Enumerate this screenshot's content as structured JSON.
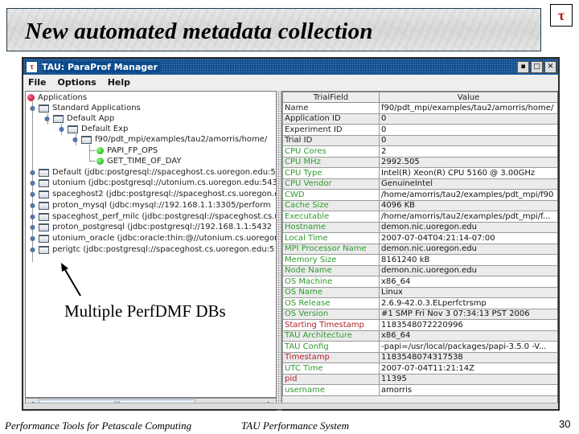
{
  "slide": {
    "title": "New automated metadata collection",
    "logo_glyph": "τ",
    "annotation": "Multiple PerfDMF DBs",
    "footer_left": "Performance Tools for Petascale Computing",
    "footer_center": "TAU Performance System",
    "page_number": "30"
  },
  "window": {
    "app_icon": "τ",
    "title": "TAU: ParaProf Manager",
    "controls": {
      "minimize": "▪",
      "maximize": "□",
      "close": "✕"
    },
    "menu": [
      "File",
      "Options",
      "Help"
    ]
  },
  "tree": {
    "root": "Applications",
    "nodes": [
      {
        "label": "Standard Applications"
      },
      {
        "label": "Default App"
      },
      {
        "label": "Default Exp"
      },
      {
        "label": "f90/pdt_mpi/examples/tau2/amorris/home/"
      },
      {
        "label": "PAPI_FP_OPS"
      },
      {
        "label": "GET_TIME_OF_DAY"
      },
      {
        "label": "Default (jdbc:postgresql://spaceghost.cs.uoregon.edu:5"
      },
      {
        "label": "utonium (jdbc:postgresql://utonium.cs.uoregon.edu:543"
      },
      {
        "label": "spaceghost2 (jdbc:postgresql://spaceghost.cs.uoregon.e"
      },
      {
        "label": "proton_mysql (jdbc:mysql://192.168.1.1:3305/perform"
      },
      {
        "label": "spaceghost_perf_milc (jdbc:postgresql://spaceghost.cs.u"
      },
      {
        "label": "proton_postgresql (jdbc:postgresql://192.168.1.1:5432"
      },
      {
        "label": "utonium_oracle (jdbc:oracle:thin:@//utonium.cs.uoregon."
      },
      {
        "label": "perigtc (jdbc:postgresql://spaceghost.cs.uoregon.edu:5"
      }
    ]
  },
  "scrollbar": {
    "left": "◀",
    "right": "▶",
    "grip": "|||"
  },
  "table": {
    "headers": [
      "TrialField",
      "Value"
    ],
    "rows": [
      {
        "field": "Name",
        "value": "f90/pdt_mpi/examples/tau2/amorris/home/",
        "color": "black"
      },
      {
        "field": "Application ID",
        "value": "0",
        "color": "black"
      },
      {
        "field": "Experiment ID",
        "value": "0",
        "color": "black"
      },
      {
        "field": "Trial ID",
        "value": "0",
        "color": "black"
      },
      {
        "field": "CPU Cores",
        "value": "2",
        "color": "green"
      },
      {
        "field": "CPU MHz",
        "value": "2992.505",
        "color": "green"
      },
      {
        "field": "CPU Type",
        "value": "Intel(R) Xeon(R) CPU 5160 @ 3.00GHz",
        "color": "green"
      },
      {
        "field": "CPU Vendor",
        "value": "GenuineIntel",
        "color": "green"
      },
      {
        "field": "CWD",
        "value": "/home/amorris/tau2/examples/pdt_mpi/f90",
        "color": "green"
      },
      {
        "field": "Cache Size",
        "value": "4096 KB",
        "color": "green"
      },
      {
        "field": "Executable",
        "value": "/home/amorris/tau2/examples/pdt_mpi/f...",
        "color": "green"
      },
      {
        "field": "Hostname",
        "value": "demon.nic.uoregon.edu",
        "color": "green"
      },
      {
        "field": "Local Time",
        "value": "2007-07-04T04:21:14-07:00",
        "color": "green"
      },
      {
        "field": "MPI Processor Name",
        "value": "demon.nic.uoregon.edu",
        "color": "green"
      },
      {
        "field": "Memory Size",
        "value": "8161240 kB",
        "color": "green"
      },
      {
        "field": "Node Name",
        "value": "demon.nic.uoregon.edu",
        "color": "green"
      },
      {
        "field": "OS Machine",
        "value": "x86_64",
        "color": "green"
      },
      {
        "field": "OS Name",
        "value": "Linux",
        "color": "green"
      },
      {
        "field": "OS Release",
        "value": "2.6.9-42.0.3.ELperfctrsmp",
        "color": "green"
      },
      {
        "field": "OS Version",
        "value": "#1 SMP Fri Nov 3 07:34:13 PST 2006",
        "color": "green"
      },
      {
        "field": "Starting Timestamp",
        "value": "1183548072220996",
        "color": "red"
      },
      {
        "field": "TAU Architecture",
        "value": "x86_64",
        "color": "green"
      },
      {
        "field": "TAU Config",
        "value": "-papi=/usr/local/packages/papi-3.5.0 -V...",
        "color": "green"
      },
      {
        "field": "Timestamp",
        "value": "1183548074317538",
        "color": "red"
      },
      {
        "field": "UTC Time",
        "value": "2007-07-04T11:21:14Z",
        "color": "green"
      },
      {
        "field": "pid",
        "value": "11395",
        "color": "red"
      },
      {
        "field": "username",
        "value": "amorris",
        "color": "green"
      }
    ]
  }
}
